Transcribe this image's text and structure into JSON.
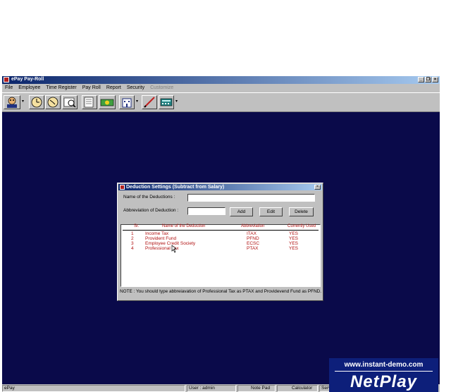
{
  "window": {
    "title": "ePay Pay-Roll",
    "minimize": "_",
    "restore": "×",
    "close": "×"
  },
  "menu": [
    {
      "label": "File"
    },
    {
      "label": "Employee"
    },
    {
      "label": "Time Register"
    },
    {
      "label": "Pay Roll"
    },
    {
      "label": "Report"
    },
    {
      "label": "Security"
    },
    {
      "label": "Customize"
    }
  ],
  "dialog": {
    "title": "Deduction Settings (Subtract from Salary)",
    "close": "×",
    "name_label": "Name of the Deductions :",
    "name_value": "",
    "abbr_label": "Abbreviation of Deduction :",
    "abbr_value": "",
    "buttons": {
      "add": "Add",
      "edit": "Edit",
      "delete": "Delete"
    },
    "table": {
      "headers": [
        "Sr.",
        "Name of the Deduction",
        "Abbreviation",
        "Currently Used"
      ],
      "rows": [
        [
          "1",
          "Income Tax",
          "ITAX",
          "YES"
        ],
        [
          "2",
          "Provident Fund",
          "PFND",
          "YES"
        ],
        [
          "3",
          "Employee Credit Society",
          "ECSC",
          "YES"
        ],
        [
          "4",
          "Professional Tax",
          "PTAX",
          "YES"
        ]
      ]
    },
    "note": "NOTE : You should type abbreiavation of Professional Tax as PTAX and Providevend Fund as PFND."
  },
  "status": {
    "app": "ePay",
    "user": "User : admin",
    "notepad": "Note Pad",
    "calculator": "Calculator",
    "extra": "Serv"
  },
  "watermark": {
    "url": "www.instant-demo.com",
    "brand": "NetPlay"
  }
}
